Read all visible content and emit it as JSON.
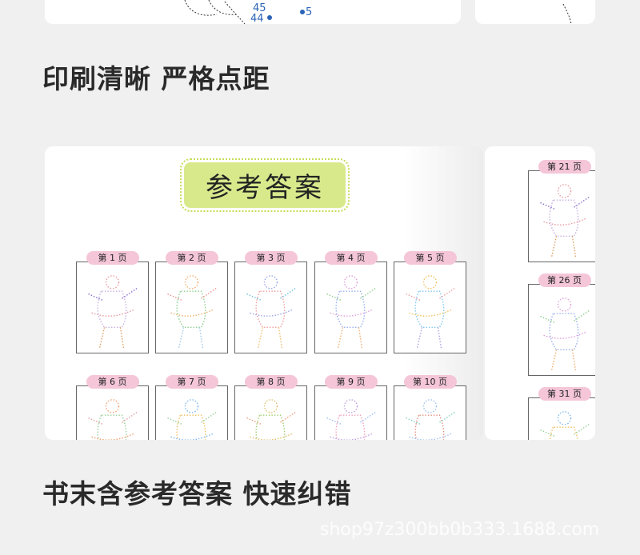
{
  "top_fragment": {
    "label_45": "45",
    "label_44": "44",
    "label_5": "5"
  },
  "heading_print": "印刷清晰 严格点距",
  "answer_title": "参考答案",
  "pages_row1": [
    "第 1 页",
    "第 2 页",
    "第 3 页",
    "第 4 页",
    "第 5 页"
  ],
  "pages_row2": [
    "第 6 页",
    "第 7 页",
    "第 8 页",
    "第 9 页",
    "第 10 页"
  ],
  "pages_right": [
    "第 21 页",
    "第 26 页",
    "第 31 页"
  ],
  "heading_answers": "书末含参考答案 快速纠错",
  "watermark": "shop97z300bb0b333.1688.com",
  "colors": {
    "title_bg": "#d8e98c",
    "tab_bg": "#f4c6d8",
    "heading": "#2a2a2a",
    "number_blue": "#2b63b8"
  }
}
